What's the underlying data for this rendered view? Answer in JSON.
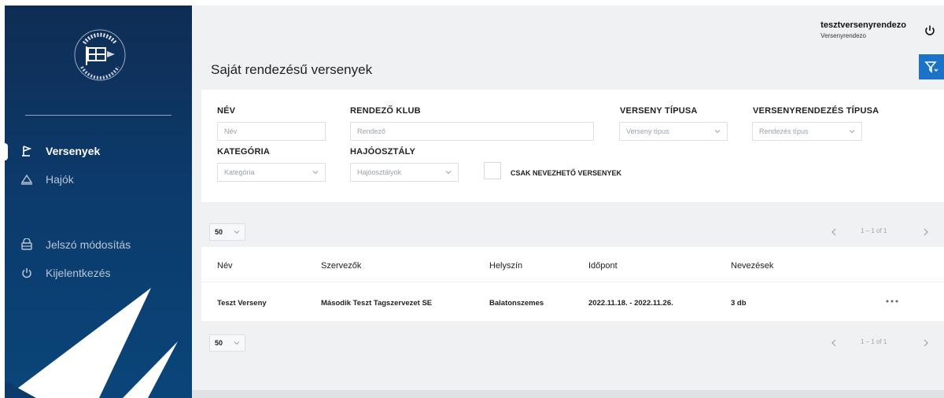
{
  "sidebar": {
    "logo": "sailing-federation-logo",
    "items": [
      {
        "label": "Versenyek",
        "icon": "flag-icon",
        "active": true
      },
      {
        "label": "Hajók",
        "icon": "boat-icon",
        "active": false
      },
      {
        "label": "Jelszó módosítás",
        "icon": "lock-icon",
        "active": false
      },
      {
        "label": "Kijelentkezés",
        "icon": "power-icon",
        "active": false
      }
    ]
  },
  "header": {
    "title": "Saját rendezésű versenyek",
    "user_name": "tesztversenyrendezo",
    "user_role": "Versenyrendezo"
  },
  "filters": {
    "name_label": "NÉV",
    "name_placeholder": "Név",
    "club_label": "RENDEZŐ KLUB",
    "club_placeholder": "Rendező",
    "race_type_label": "VERSENY TÍPUSA",
    "race_type_placeholder": "Verseny típus",
    "org_type_label": "VERSENYRENDEZÉS TÍPUSA",
    "org_type_placeholder": "Rendezés típus",
    "category_label": "KATEGÓRIA",
    "category_placeholder": "Kategória",
    "boatclass_label": "HAJÓOSZTÁLY",
    "boatclass_placeholder": "Hajóosztályok",
    "only_open_label": "CSAK NEVEZHETŐ VERSENYEK"
  },
  "pagination": {
    "per_page": "50",
    "range": "1 – 1 of 1"
  },
  "table": {
    "columns": [
      "Név",
      "Szervezők",
      "Helyszín",
      "Időpont",
      "Nevezések"
    ],
    "rows": [
      [
        "Teszt Verseny",
        "Második Teszt Tagszervezet SE",
        "Balatonszemes",
        "2022.11.18. - 2022.11.26.",
        "3 db"
      ]
    ]
  },
  "colors": {
    "sidebar": "#0f2d54",
    "accent": "#1a73c9",
    "background": "#f0f1f3"
  }
}
